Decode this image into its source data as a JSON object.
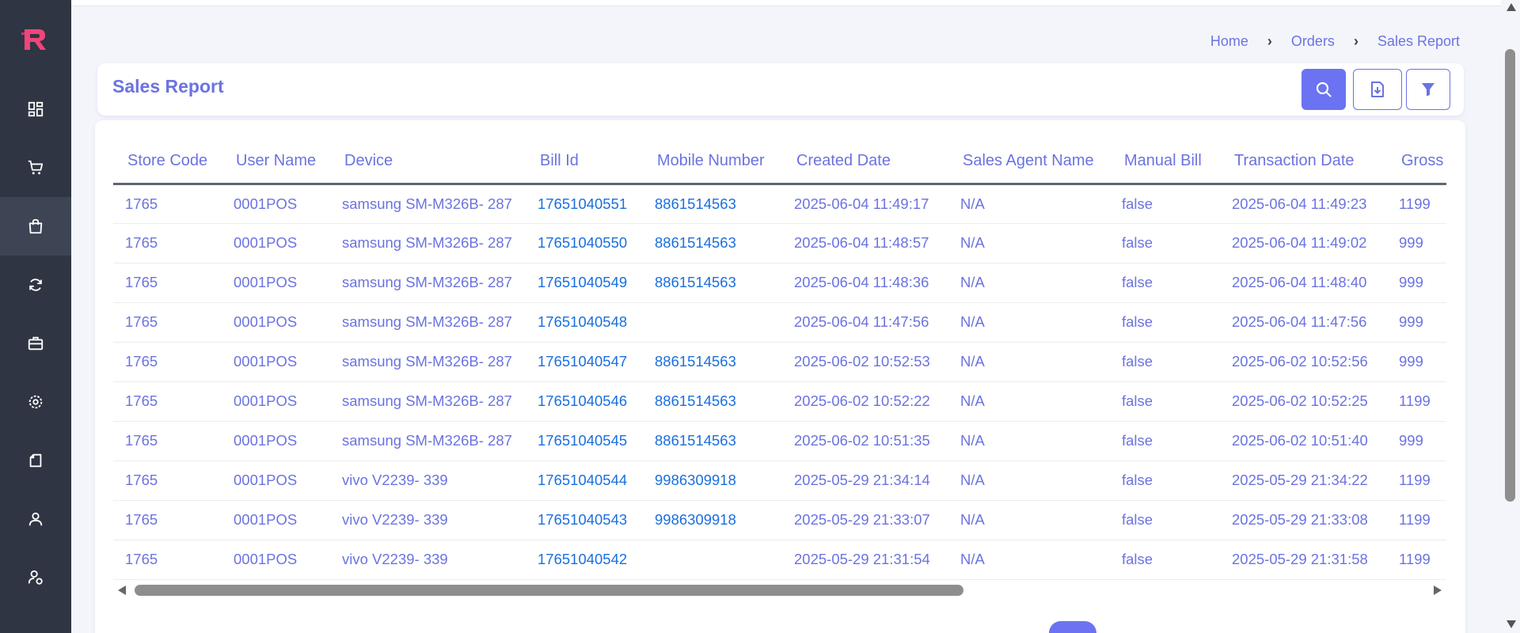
{
  "sidebar": {
    "logo": "logo-icon",
    "items": [
      {
        "name": "dashboard",
        "icon": "dashboard-icon",
        "active": false
      },
      {
        "name": "cart",
        "icon": "cart-icon",
        "active": false
      },
      {
        "name": "orders",
        "icon": "shopping-bag-icon",
        "active": true
      },
      {
        "name": "sync",
        "icon": "refresh-icon",
        "active": false
      },
      {
        "name": "briefcase",
        "icon": "briefcase-icon",
        "active": false
      },
      {
        "name": "settings",
        "icon": "gear-icon",
        "active": false
      },
      {
        "name": "reports",
        "icon": "document-icon",
        "active": false
      },
      {
        "name": "user",
        "icon": "user-icon",
        "active": false
      },
      {
        "name": "user-settings",
        "icon": "user-gear-icon",
        "active": false
      }
    ],
    "colors": {
      "background": "#2f3542",
      "active": "#3d4555",
      "logo": "#f0457a"
    }
  },
  "breadcrumb": {
    "home": "Home",
    "orders": "Orders",
    "current": "Sales Report"
  },
  "header": {
    "title": "Sales Report",
    "buttons": [
      "search-icon",
      "download-icon",
      "filter-icon"
    ]
  },
  "table": {
    "columns": [
      "Store Code",
      "User Name",
      "Device",
      "Bill Id",
      "Mobile Number",
      "Created Date",
      "Sales Agent Name",
      "Manual Bill",
      "Transaction Date",
      "Gross T"
    ],
    "rows": [
      [
        "1765",
        "0001POS",
        "samsung SM-M326B- 287",
        "17651040551",
        "8861514563",
        "2025-06-04 11:49:17",
        "N/A",
        "false",
        "2025-06-04 11:49:23",
        "1199"
      ],
      [
        "1765",
        "0001POS",
        "samsung SM-M326B- 287",
        "17651040550",
        "8861514563",
        "2025-06-04 11:48:57",
        "N/A",
        "false",
        "2025-06-04 11:49:02",
        "999"
      ],
      [
        "1765",
        "0001POS",
        "samsung SM-M326B- 287",
        "17651040549",
        "8861514563",
        "2025-06-04 11:48:36",
        "N/A",
        "false",
        "2025-06-04 11:48:40",
        "999"
      ],
      [
        "1765",
        "0001POS",
        "samsung SM-M326B- 287",
        "17651040548",
        "",
        "2025-06-04 11:47:56",
        "N/A",
        "false",
        "2025-06-04 11:47:56",
        "999"
      ],
      [
        "1765",
        "0001POS",
        "samsung SM-M326B- 287",
        "17651040547",
        "8861514563",
        "2025-06-02 10:52:53",
        "N/A",
        "false",
        "2025-06-02 10:52:56",
        "999"
      ],
      [
        "1765",
        "0001POS",
        "samsung SM-M326B- 287",
        "17651040546",
        "8861514563",
        "2025-06-02 10:52:22",
        "N/A",
        "false",
        "2025-06-02 10:52:25",
        "1199"
      ],
      [
        "1765",
        "0001POS",
        "samsung SM-M326B- 287",
        "17651040545",
        "8861514563",
        "2025-06-02 10:51:35",
        "N/A",
        "false",
        "2025-06-02 10:51:40",
        "999"
      ],
      [
        "1765",
        "0001POS",
        "vivo V2239- 339",
        "17651040544",
        "9986309918",
        "2025-05-29 21:34:14",
        "N/A",
        "false",
        "2025-05-29 21:34:22",
        "1199"
      ],
      [
        "1765",
        "0001POS",
        "vivo V2239- 339",
        "17651040543",
        "9986309918",
        "2025-05-29 21:33:07",
        "N/A",
        "false",
        "2025-05-29 21:33:08",
        "1199"
      ],
      [
        "1765",
        "0001POS",
        "vivo V2239- 339",
        "17651040542",
        "",
        "2025-05-29 21:31:54",
        "N/A",
        "false",
        "2025-05-29 21:31:58",
        "1199"
      ]
    ]
  },
  "colors": {
    "accent": "#6b73e0",
    "link": "#1a6fe0",
    "page_bg": "#f4f5fb"
  }
}
